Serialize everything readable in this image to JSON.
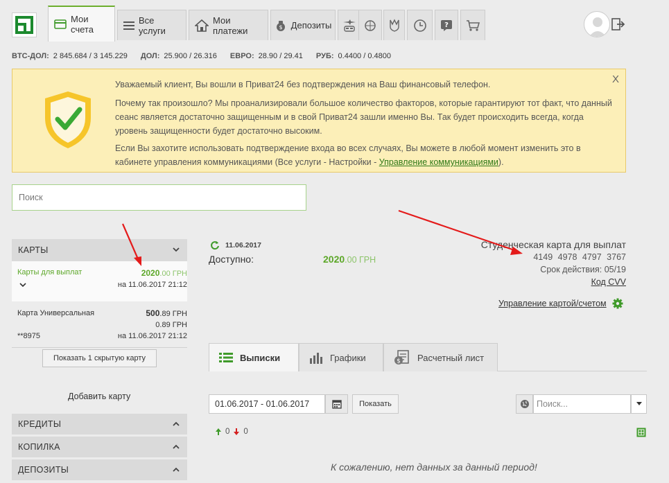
{
  "nav": {
    "tabs": [
      {
        "label": "Мои счета"
      },
      {
        "label": "Все услуги"
      },
      {
        "label": "Мои платежи"
      },
      {
        "label": "Депозиты"
      }
    ]
  },
  "rates": [
    {
      "name": "BTC-ДОЛ:",
      "value": "2 845.684 / 3 145.229"
    },
    {
      "name": "ДОЛ:",
      "value": "25.900 / 26.316"
    },
    {
      "name": "ЕВРО:",
      "value": "28.90 / 29.41"
    },
    {
      "name": "РУБ:",
      "value": "0.4400 / 0.4800"
    }
  ],
  "notice": {
    "close": "X",
    "line1": "Уважаемый клиент, Вы вошли в Приват24 без подтверждения на Ваш финансовый телефон.",
    "line2": "Почему так произошло? Мы проанализировали большое количество факторов, которые гарантируют тот факт, что данный сеанс является достаточно защищенным и в свой Приват24 зашли именно Вы. Так будет происходить всегда, когда уровень защищенности будет достаточно высоким.",
    "line3_pre": "Если Вы захотите использовать подтверждение входа во всех случаях, Вы можете в любой момент изменить это в кабинете управления коммуникациями (Все услуги - Настройки - ",
    "line3_link": "Управление коммуникациями",
    "line3_post": ")."
  },
  "search": {
    "placeholder": "Поиск"
  },
  "cards_panel": {
    "title": "КАРТЫ",
    "cards": [
      {
        "name": "Карты для выплат",
        "amount_int": "2020",
        "amount_frac": ".00 ГРН",
        "date": "на 11.06.2017 21:12"
      },
      {
        "name": "Карта Универсальная",
        "amount_int": "500",
        "amount_frac": ".89 ГРН",
        "amount2": "0.89 ГРН",
        "mask": "**8975",
        "date": "на 11.06.2017 21:12"
      }
    ],
    "show_hidden": "Показать 1 скрытую карту",
    "add_card": "Добавить карту"
  },
  "sections": [
    {
      "title": "КРЕДИТЫ"
    },
    {
      "title": "КОПИЛКА"
    },
    {
      "title": "ДЕПОЗИТЫ"
    }
  ],
  "main": {
    "date": "11.06.2017",
    "available_label": "Доступно:",
    "available_int": "2020",
    "available_frac": ".00 ГРН",
    "card_name": "Студенческая карта для выплат",
    "card_number": "4149 4978 4797 3767",
    "expiry": "Срок действия: 05/19",
    "cvv": "Код CVV",
    "manage": "Управление картой/счетом"
  },
  "subtabs": [
    {
      "label": "Выписки"
    },
    {
      "label": "Графики"
    },
    {
      "label": "Расчетный лист"
    }
  ],
  "filters": {
    "date_range": "01.06.2017 - 01.06.2017",
    "show": "Показать",
    "search_placeholder": "Поиск..."
  },
  "counts": {
    "in": "0",
    "out": "0"
  },
  "no_data": "К сожалению, нет данных за данный период!",
  "colors": {
    "accent": "#5ca728",
    "notice_bg": "#fcefb8",
    "arrow": "#e41b1b"
  }
}
